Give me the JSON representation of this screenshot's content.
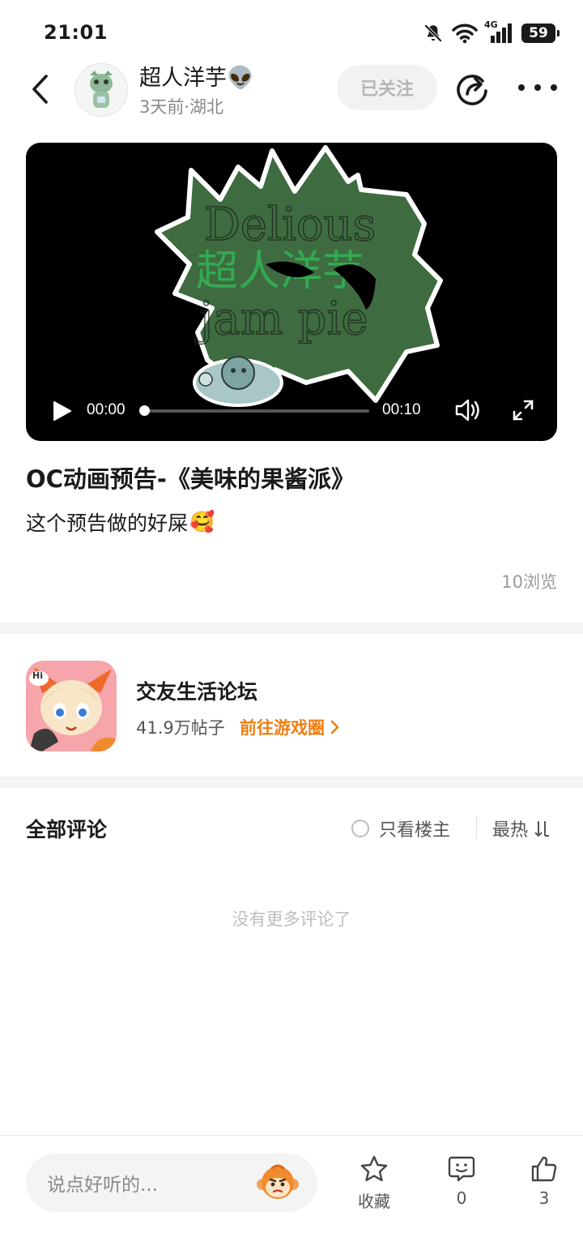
{
  "status_bar": {
    "time": "21:01",
    "network": "4G",
    "battery": "59"
  },
  "header": {
    "username": "超人洋芋👽",
    "meta": "3天前·湖北",
    "follow_label": "已关注"
  },
  "video": {
    "current_time": "00:00",
    "duration": "00:10",
    "progress": 0,
    "overlay_text": "超人洋芋",
    "art_text_line1": "Delious",
    "art_text_line2": "jam pie"
  },
  "post": {
    "title": "OC动画预告-《美味的果酱派》",
    "body": "这个预告做的好屎",
    "body_emoji": "🥰",
    "views": "10浏览"
  },
  "forum": {
    "name": "交友生活论坛",
    "posts": "41.9万帖子",
    "link_label": "前往游戏圈",
    "icon_badge": "Hi"
  },
  "comments": {
    "title": "全部评论",
    "only_host_label": "只看楼主",
    "sort_label": "最热",
    "empty_text": "没有更多评论了"
  },
  "bottom_bar": {
    "input_placeholder": "说点好听的...",
    "favorite_label": "收藏",
    "comment_count": "0",
    "like_count": "3"
  },
  "colors": {
    "accent_orange": "#f07d11",
    "video_bg": "#000000",
    "art_green": "#3f6b41",
    "overlay_green": "#2fbf58"
  }
}
